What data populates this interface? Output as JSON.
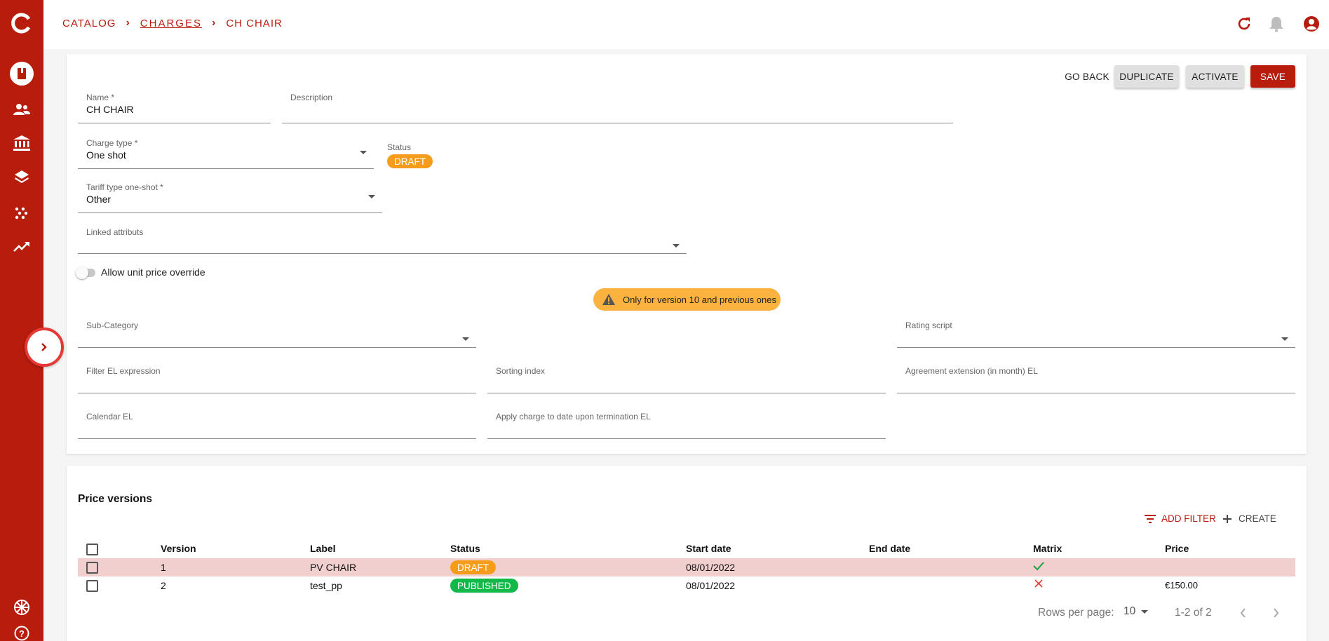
{
  "breadcrumb": {
    "catalog": "CATALOG",
    "charges": "CHARGES",
    "current": "CH CHAIR"
  },
  "toolbar": {
    "go_back": "GO BACK",
    "duplicate": "DUPLICATE",
    "activate": "ACTIVATE",
    "save": "SAVE"
  },
  "form": {
    "name": {
      "label": "Name *",
      "value": "CH CHAIR"
    },
    "description": {
      "label": "Description",
      "value": ""
    },
    "charge_type": {
      "label": "Charge type *",
      "value": "One shot"
    },
    "status": {
      "label": "Status",
      "value": "DRAFT"
    },
    "tariff_type": {
      "label": "Tariff type one-shot *",
      "value": "Other"
    },
    "linked_attributs": {
      "label": "Linked attributs",
      "value": ""
    },
    "allow_override": {
      "label": "Allow unit price override",
      "checked": false
    },
    "warning": "Only for version 10 and previous ones",
    "sub_category": {
      "label": "Sub-Category",
      "value": ""
    },
    "rating_script": {
      "label": "Rating script",
      "value": ""
    },
    "filter_el": {
      "label": "Filter EL expression",
      "value": ""
    },
    "sorting_index": {
      "label": "Sorting index",
      "value": ""
    },
    "agreement_ext": {
      "label": "Agreement extension (in month) EL",
      "value": ""
    },
    "calendar_el": {
      "label": "Calendar EL",
      "value": ""
    },
    "apply_charge": {
      "label": "Apply charge to date upon termination EL",
      "value": ""
    }
  },
  "price_versions": {
    "title": "Price versions",
    "add_filter": "ADD FILTER",
    "create": "CREATE",
    "columns": [
      "Version",
      "Label",
      "Status",
      "Start date",
      "End date",
      "Matrix",
      "Price"
    ],
    "rows": [
      {
        "version": "1",
        "label": "PV CHAIR",
        "status": "DRAFT",
        "start": "08/01/2022",
        "end": "",
        "matrix": "check-icon",
        "price": ""
      },
      {
        "version": "2",
        "label": "test_pp",
        "status": "PUBLISHED",
        "start": "08/01/2022",
        "end": "",
        "matrix": "close-icon",
        "price": "€150.00"
      }
    ],
    "rows_per_page_label": "Rows per page:",
    "rows_per_page": "10",
    "range": "1-2 of 2"
  },
  "colors": {
    "brand": "#b71c0c",
    "draft": "#f59d1b",
    "published": "#13b84a",
    "warning": "#fbb23e"
  }
}
